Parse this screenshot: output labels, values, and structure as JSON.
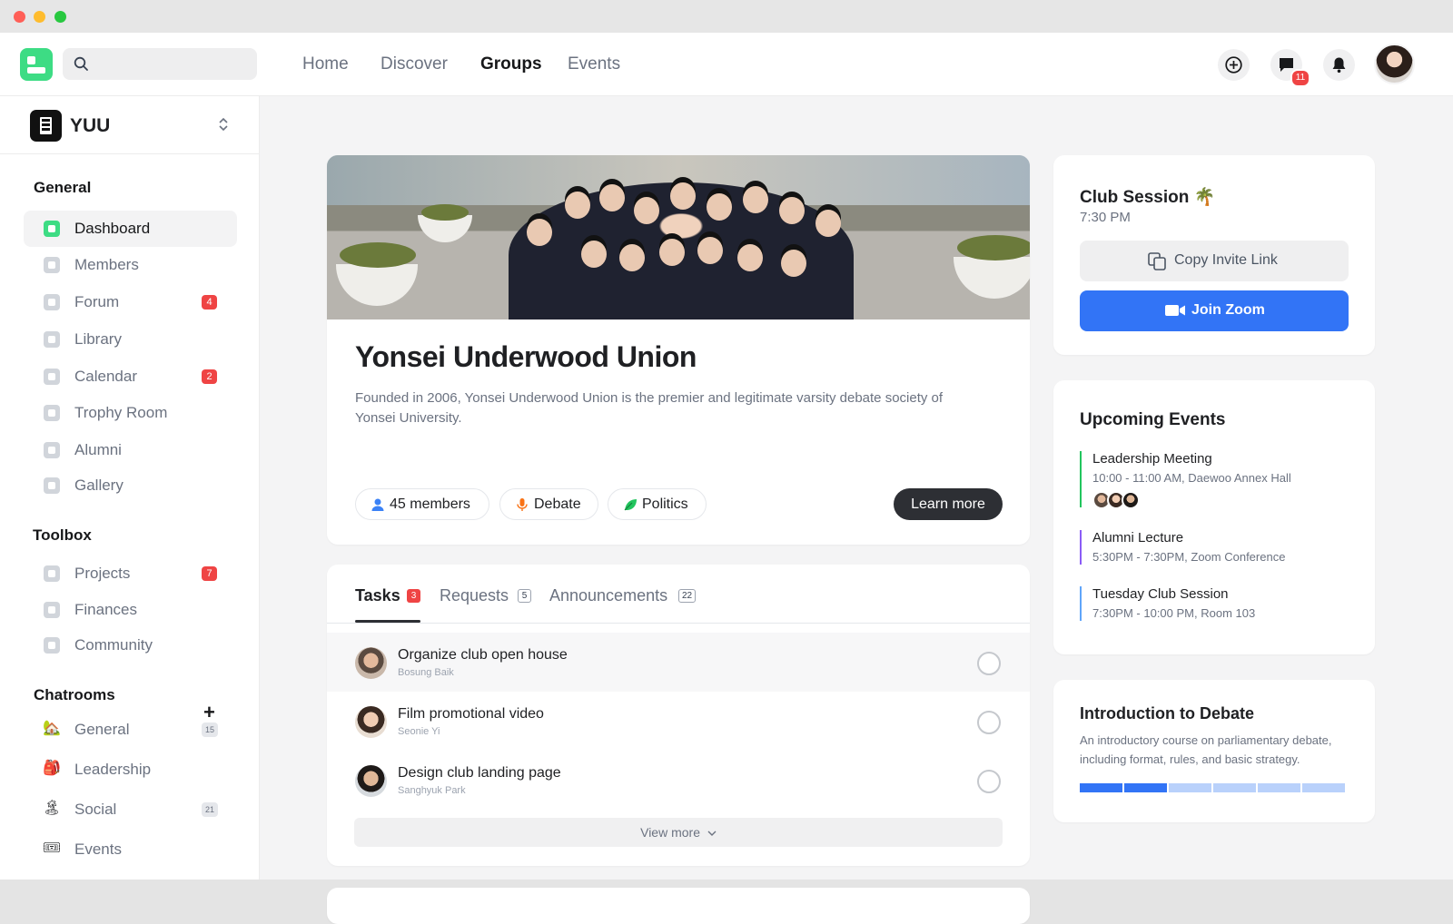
{
  "topnav": {
    "search_placeholder": "",
    "links": [
      "Home",
      "Discover",
      "Groups",
      "Events"
    ],
    "active_link": "Groups",
    "messages_badge": "11"
  },
  "sidebar": {
    "org_name": "YUU",
    "general_title": "General",
    "general_items": [
      {
        "label": "Dashboard",
        "badge": ""
      },
      {
        "label": "Members",
        "badge": ""
      },
      {
        "label": "Forum",
        "badge": "4"
      },
      {
        "label": "Library",
        "badge": ""
      },
      {
        "label": "Calendar",
        "badge": "2"
      },
      {
        "label": "Trophy Room",
        "badge": ""
      },
      {
        "label": "Alumni",
        "badge": ""
      },
      {
        "label": "Gallery",
        "badge": ""
      }
    ],
    "toolbox_title": "Toolbox",
    "toolbox_items": [
      {
        "label": "Projects",
        "badge": "7"
      },
      {
        "label": "Finances",
        "badge": ""
      },
      {
        "label": "Community",
        "badge": ""
      }
    ],
    "chatrooms_title": "Chatrooms",
    "chatrooms": [
      {
        "label": "General",
        "count": "15",
        "icon": "🏡"
      },
      {
        "label": "Leadership",
        "count": "",
        "icon": "🎒"
      },
      {
        "label": "Social",
        "count": "21",
        "icon": "🏝"
      },
      {
        "label": "Events",
        "count": "",
        "icon": "🎟"
      }
    ]
  },
  "group": {
    "name": "Yonsei Underwood Union",
    "description": "Founded in 2006, Yonsei Underwood Union is the premier and legitimate varsity debate society of Yonsei University.",
    "pills": [
      "45 members",
      "Debate",
      "Politics"
    ],
    "learn_more": "Learn more"
  },
  "tasks_card": {
    "tabs": [
      {
        "label": "Tasks",
        "count": "3"
      },
      {
        "label": "Requests",
        "count": "5"
      },
      {
        "label": "Announcements",
        "count": "22"
      }
    ],
    "tasks": [
      {
        "title": "Organize club open house",
        "assignee": "Bosung Baik"
      },
      {
        "title": "Film promotional video",
        "assignee": "Seonie Yi"
      },
      {
        "title": "Design club landing page",
        "assignee": "Sanghyuk Park"
      }
    ],
    "view_more": "View more"
  },
  "session": {
    "title": "Club Session",
    "emoji": "🌴",
    "time": "7:30 PM",
    "copy_label": "Copy Invite Link",
    "zoom_label": "Join Zoom"
  },
  "events": {
    "title": "Upcoming Events",
    "items": [
      {
        "title": "Leadership Meeting",
        "detail": "10:00 - 11:00 AM, Daewoo Annex Hall",
        "color": "#22c55e"
      },
      {
        "title": "Alumni Lecture",
        "detail": "5:30PM - 7:30PM, Zoom Conference",
        "color": "#8b5cf6"
      },
      {
        "title": "Tuesday Club Session",
        "detail": "7:30PM - 10:00 PM, Room 103",
        "color": "#60a5fa"
      }
    ]
  },
  "course": {
    "title": "Introduction to Debate",
    "description": "An introductory course on parliamentary debate, including format, rules, and basic strategy.",
    "progress_completed_segments": 2,
    "progress_total_segments": 6
  },
  "colors": {
    "accent": "#3274f6",
    "brand": "#3ddc84",
    "badge": "#ef4444"
  }
}
